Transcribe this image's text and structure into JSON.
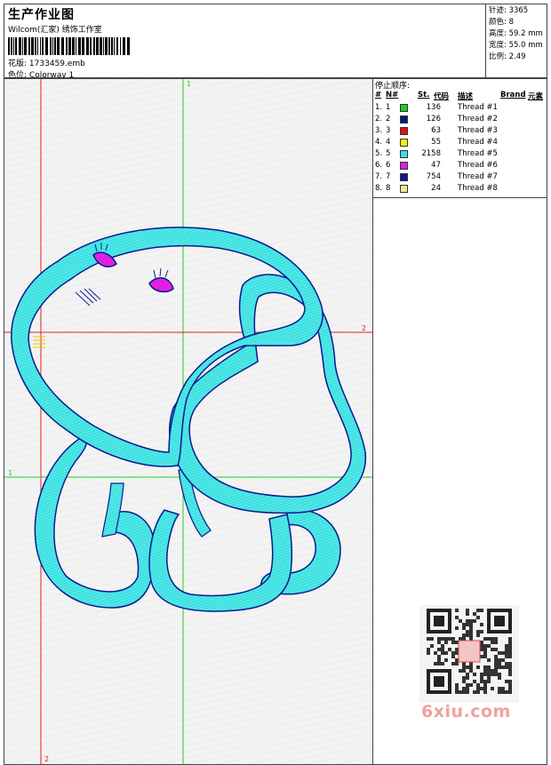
{
  "header": {
    "title": "生产作业图",
    "studio": "Wilcom(汇家) 绣饰工作室",
    "design_label": "花版:",
    "design_value": "1733459.emb",
    "colorway_label": "色位:",
    "colorway_value": "Colorway 1"
  },
  "stats": [
    {
      "label": "针迹:",
      "value": "3365"
    },
    {
      "label": "颜色:",
      "value": "8"
    },
    {
      "label": "高度:",
      "value": "59.2 mm"
    },
    {
      "label": "宽度:",
      "value": "55.0 mm"
    },
    {
      "label": "比例:",
      "value": "2.49"
    }
  ],
  "stop_order": {
    "title": "停止顺序:",
    "columns": {
      "hash": "#",
      "n": "N#",
      "st": "St.",
      "code": "代码",
      "desc": "描述",
      "brand": "Brand",
      "element": "元素"
    },
    "rows": [
      {
        "num": "1.",
        "n": "1",
        "color": "#22cc22",
        "st": "136",
        "desc": "Thread #1"
      },
      {
        "num": "2.",
        "n": "2",
        "color": "#001a80",
        "st": "126",
        "desc": "Thread #2"
      },
      {
        "num": "3.",
        "n": "3",
        "color": "#e01010",
        "st": "63",
        "desc": "Thread #3"
      },
      {
        "num": "4.",
        "n": "4",
        "color": "#f5f000",
        "st": "55",
        "desc": "Thread #4"
      },
      {
        "num": "5.",
        "n": "5",
        "color": "#3ee0e0",
        "st": "2158",
        "desc": "Thread #5"
      },
      {
        "num": "6.",
        "n": "6",
        "color": "#e020e0",
        "st": "47",
        "desc": "Thread #6"
      },
      {
        "num": "7.",
        "n": "7",
        "color": "#0a1a90",
        "st": "754",
        "desc": "Thread #7"
      },
      {
        "num": "8.",
        "n": "8",
        "color": "#f2e898",
        "st": "24",
        "desc": "Thread #8"
      }
    ]
  },
  "guides": {
    "v1": "1",
    "h2": "2",
    "h1": "1",
    "v2": "2"
  },
  "watermark": {
    "logo": "6xiu.com"
  },
  "colors": {
    "outline": "#0a1a90",
    "fill": "#3ee0e0",
    "guide_green": "#22cc22",
    "guide_red": "#e02020"
  }
}
